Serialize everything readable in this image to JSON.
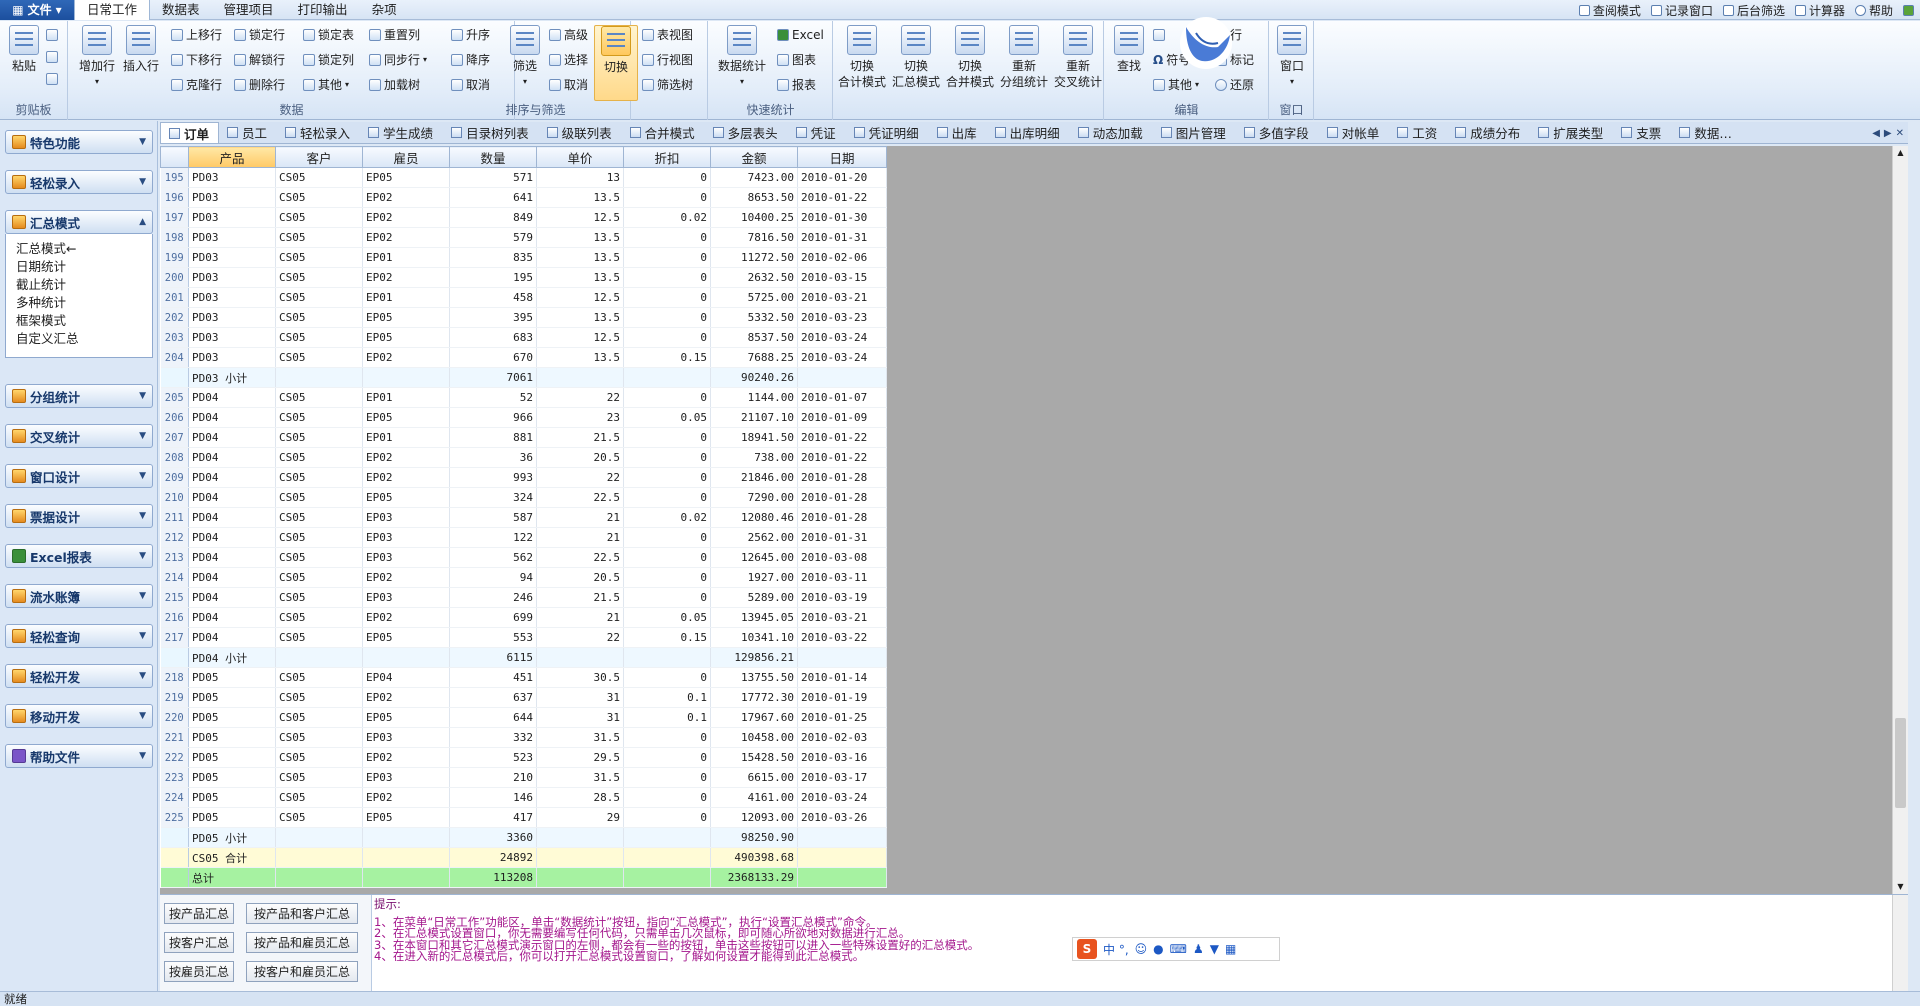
{
  "menubar": {
    "file": "文件",
    "tabs": [
      "日常工作",
      "数据表",
      "管理项目",
      "打印输出",
      "杂项"
    ],
    "active": 0
  },
  "topright": [
    "查阅模式",
    "记录窗口",
    "后台筛选",
    "计算器",
    "帮助"
  ],
  "ribbon": {
    "clipboard": {
      "label": "剪贴板",
      "paste": "粘贴"
    },
    "data": {
      "label": "数据",
      "add_row": "增加行",
      "insert_row": "插入行",
      "small": [
        "上移行",
        "下移行",
        "克隆行",
        "锁定行",
        "解锁行",
        "删除行",
        "锁定表",
        "锁定列",
        "其他",
        "重置列",
        "同步行",
        "加载树"
      ]
    },
    "sort": {
      "label": "排序与筛选",
      "small": [
        "升序",
        "降序",
        "取消",
        "高级",
        "选择",
        "取消"
      ],
      "filter": "筛选",
      "switch": "切换"
    },
    "view": {
      "label": "",
      "small": [
        "表视图",
        "行视图",
        "筛选树"
      ]
    },
    "quick": {
      "label": "快速统计",
      "data_stat": "数据统计",
      "small": [
        "Excel",
        "图表",
        "报表"
      ]
    },
    "modes": [
      "切换\n合计模式",
      "切换\n汇总模式",
      "切换\n合并模式",
      "重新\n分组统计",
      "重新\n交叉统计"
    ],
    "edit": {
      "label": "编辑",
      "find": "查找",
      "small": [
        "符号",
        "其他",
        "标记",
        "还原",
        "行"
      ]
    },
    "window": {
      "label": "窗口",
      "btn": "窗口"
    }
  },
  "nav": {
    "buttons": [
      "特色功能",
      "轻松录入",
      "汇总模式",
      "分组统计",
      "交叉统计",
      "窗口设计",
      "票据设计",
      "Excel报表",
      "流水账簿",
      "轻松查询",
      "轻松开发",
      "移动开发",
      "帮助文件"
    ],
    "panel_items": [
      "汇总模式←",
      "日期统计",
      "截止统计",
      "多种统计",
      "框架模式",
      "自定义汇总"
    ]
  },
  "doctabs": [
    "订单",
    "员工",
    "轻松录入",
    "学生成绩",
    "目录树列表",
    "级联列表",
    "合并模式",
    "多层表头",
    "凭证",
    "凭证明细",
    "出库",
    "出库明细",
    "动态加载",
    "图片管理",
    "多值字段",
    "对帐单",
    "工资",
    "成绩分布",
    "扩展类型",
    "支票",
    "数据…"
  ],
  "grid": {
    "headers": [
      "产品",
      "客户",
      "雇员",
      "数量",
      "单价",
      "折扣",
      "金额",
      "日期"
    ],
    "rows": [
      [
        "195",
        "PD03",
        "CS05",
        "EP05",
        "571",
        "13",
        "0",
        "7423.00",
        "2010-01-20",
        "d"
      ],
      [
        "196",
        "PD03",
        "CS05",
        "EP02",
        "641",
        "13.5",
        "0",
        "8653.50",
        "2010-01-22",
        "d"
      ],
      [
        "197",
        "PD03",
        "CS05",
        "EP02",
        "849",
        "12.5",
        "0.02",
        "10400.25",
        "2010-01-30",
        "d"
      ],
      [
        "198",
        "PD03",
        "CS05",
        "EP02",
        "579",
        "13.5",
        "0",
        "7816.50",
        "2010-01-31",
        "d"
      ],
      [
        "199",
        "PD03",
        "CS05",
        "EP01",
        "835",
        "13.5",
        "0",
        "11272.50",
        "2010-02-06",
        "d"
      ],
      [
        "200",
        "PD03",
        "CS05",
        "EP02",
        "195",
        "13.5",
        "0",
        "2632.50",
        "2010-03-15",
        "d"
      ],
      [
        "201",
        "PD03",
        "CS05",
        "EP01",
        "458",
        "12.5",
        "0",
        "5725.00",
        "2010-03-21",
        "d"
      ],
      [
        "202",
        "PD03",
        "CS05",
        "EP05",
        "395",
        "13.5",
        "0",
        "5332.50",
        "2010-03-23",
        "d"
      ],
      [
        "203",
        "PD03",
        "CS05",
        "EP05",
        "683",
        "12.5",
        "0",
        "8537.50",
        "2010-03-24",
        "d"
      ],
      [
        "204",
        "PD03",
        "CS05",
        "EP02",
        "670",
        "13.5",
        "0.15",
        "7688.25",
        "2010-03-24",
        "d"
      ],
      [
        "",
        "PD03 小计",
        "",
        "",
        "7061",
        "",
        "",
        "90240.26",
        "",
        "sub"
      ],
      [
        "205",
        "PD04",
        "CS05",
        "EP01",
        "52",
        "22",
        "0",
        "1144.00",
        "2010-01-07",
        "d"
      ],
      [
        "206",
        "PD04",
        "CS05",
        "EP05",
        "966",
        "23",
        "0.05",
        "21107.10",
        "2010-01-09",
        "d"
      ],
      [
        "207",
        "PD04",
        "CS05",
        "EP01",
        "881",
        "21.5",
        "0",
        "18941.50",
        "2010-01-22",
        "d"
      ],
      [
        "208",
        "PD04",
        "CS05",
        "EP02",
        "36",
        "20.5",
        "0",
        "738.00",
        "2010-01-22",
        "d"
      ],
      [
        "209",
        "PD04",
        "CS05",
        "EP02",
        "993",
        "22",
        "0",
        "21846.00",
        "2010-01-28",
        "d"
      ],
      [
        "210",
        "PD04",
        "CS05",
        "EP05",
        "324",
        "22.5",
        "0",
        "7290.00",
        "2010-01-28",
        "d"
      ],
      [
        "211",
        "PD04",
        "CS05",
        "EP03",
        "587",
        "21",
        "0.02",
        "12080.46",
        "2010-01-28",
        "d"
      ],
      [
        "212",
        "PD04",
        "CS05",
        "EP03",
        "122",
        "21",
        "0",
        "2562.00",
        "2010-01-31",
        "d"
      ],
      [
        "213",
        "PD04",
        "CS05",
        "EP03",
        "562",
        "22.5",
        "0",
        "12645.00",
        "2010-03-08",
        "d"
      ],
      [
        "214",
        "PD04",
        "CS05",
        "EP02",
        "94",
        "20.5",
        "0",
        "1927.00",
        "2010-03-11",
        "d"
      ],
      [
        "215",
        "PD04",
        "CS05",
        "EP03",
        "246",
        "21.5",
        "0",
        "5289.00",
        "2010-03-19",
        "d"
      ],
      [
        "216",
        "PD04",
        "CS05",
        "EP02",
        "699",
        "21",
        "0.05",
        "13945.05",
        "2010-03-21",
        "d"
      ],
      [
        "217",
        "PD04",
        "CS05",
        "EP05",
        "553",
        "22",
        "0.15",
        "10341.10",
        "2010-03-22",
        "d"
      ],
      [
        "",
        "PD04 小计",
        "",
        "",
        "6115",
        "",
        "",
        "129856.21",
        "",
        "sub"
      ],
      [
        "218",
        "PD05",
        "CS05",
        "EP04",
        "451",
        "30.5",
        "0",
        "13755.50",
        "2010-01-14",
        "d"
      ],
      [
        "219",
        "PD05",
        "CS05",
        "EP02",
        "637",
        "31",
        "0.1",
        "17772.30",
        "2010-01-19",
        "d"
      ],
      [
        "220",
        "PD05",
        "CS05",
        "EP05",
        "644",
        "31",
        "0.1",
        "17967.60",
        "2010-01-25",
        "d"
      ],
      [
        "221",
        "PD05",
        "CS05",
        "EP03",
        "332",
        "31.5",
        "0",
        "10458.00",
        "2010-02-03",
        "d"
      ],
      [
        "222",
        "PD05",
        "CS05",
        "EP02",
        "523",
        "29.5",
        "0",
        "15428.50",
        "2010-03-16",
        "d"
      ],
      [
        "223",
        "PD05",
        "CS05",
        "EP03",
        "210",
        "31.5",
        "0",
        "6615.00",
        "2010-03-17",
        "d"
      ],
      [
        "224",
        "PD05",
        "CS05",
        "EP02",
        "146",
        "28.5",
        "0",
        "4161.00",
        "2010-03-24",
        "d"
      ],
      [
        "225",
        "PD05",
        "CS05",
        "EP05",
        "417",
        "29",
        "0",
        "12093.00",
        "2010-03-26",
        "d"
      ],
      [
        "",
        "PD05 小计",
        "",
        "",
        "3360",
        "",
        "",
        "98250.90",
        "",
        "sub"
      ],
      [
        "",
        "CS05 合计",
        "",
        "",
        "24892",
        "",
        "",
        "490398.68",
        "",
        "grp"
      ],
      [
        "",
        "总计",
        "",
        "",
        "113208",
        "",
        "",
        "2368133.29",
        "",
        "tot"
      ]
    ]
  },
  "bottom": {
    "buttons": [
      "按产品汇总",
      "按产品和客户汇总",
      "按客户汇总",
      "按产品和雇员汇总",
      "按雇员汇总",
      "按客户和雇员汇总"
    ],
    "hint_title": "提示:",
    "hints": [
      "1、在菜单“日常工作”功能区，单击“数据统计”按钮，指向“汇总模式”，执行“设置汇总模式”命令。",
      "2、在汇总模式设置窗口，你无需要编写任何代码，只需单击几次鼠标，即可随心所欲地对数据进行汇总。",
      "3、在本窗口和其它汇总模式演示窗口的左侧，都会有一些的按钮，单击这些按钮可以进入一些特殊设置好的汇总模式。",
      "4、在进入新的汇总模式后，你可以打开汇总模式设置窗口，了解如何设置才能得到此汇总模式。"
    ]
  },
  "ime": {
    "logo": "S",
    "text": "中 °,"
  },
  "status": "就绪"
}
